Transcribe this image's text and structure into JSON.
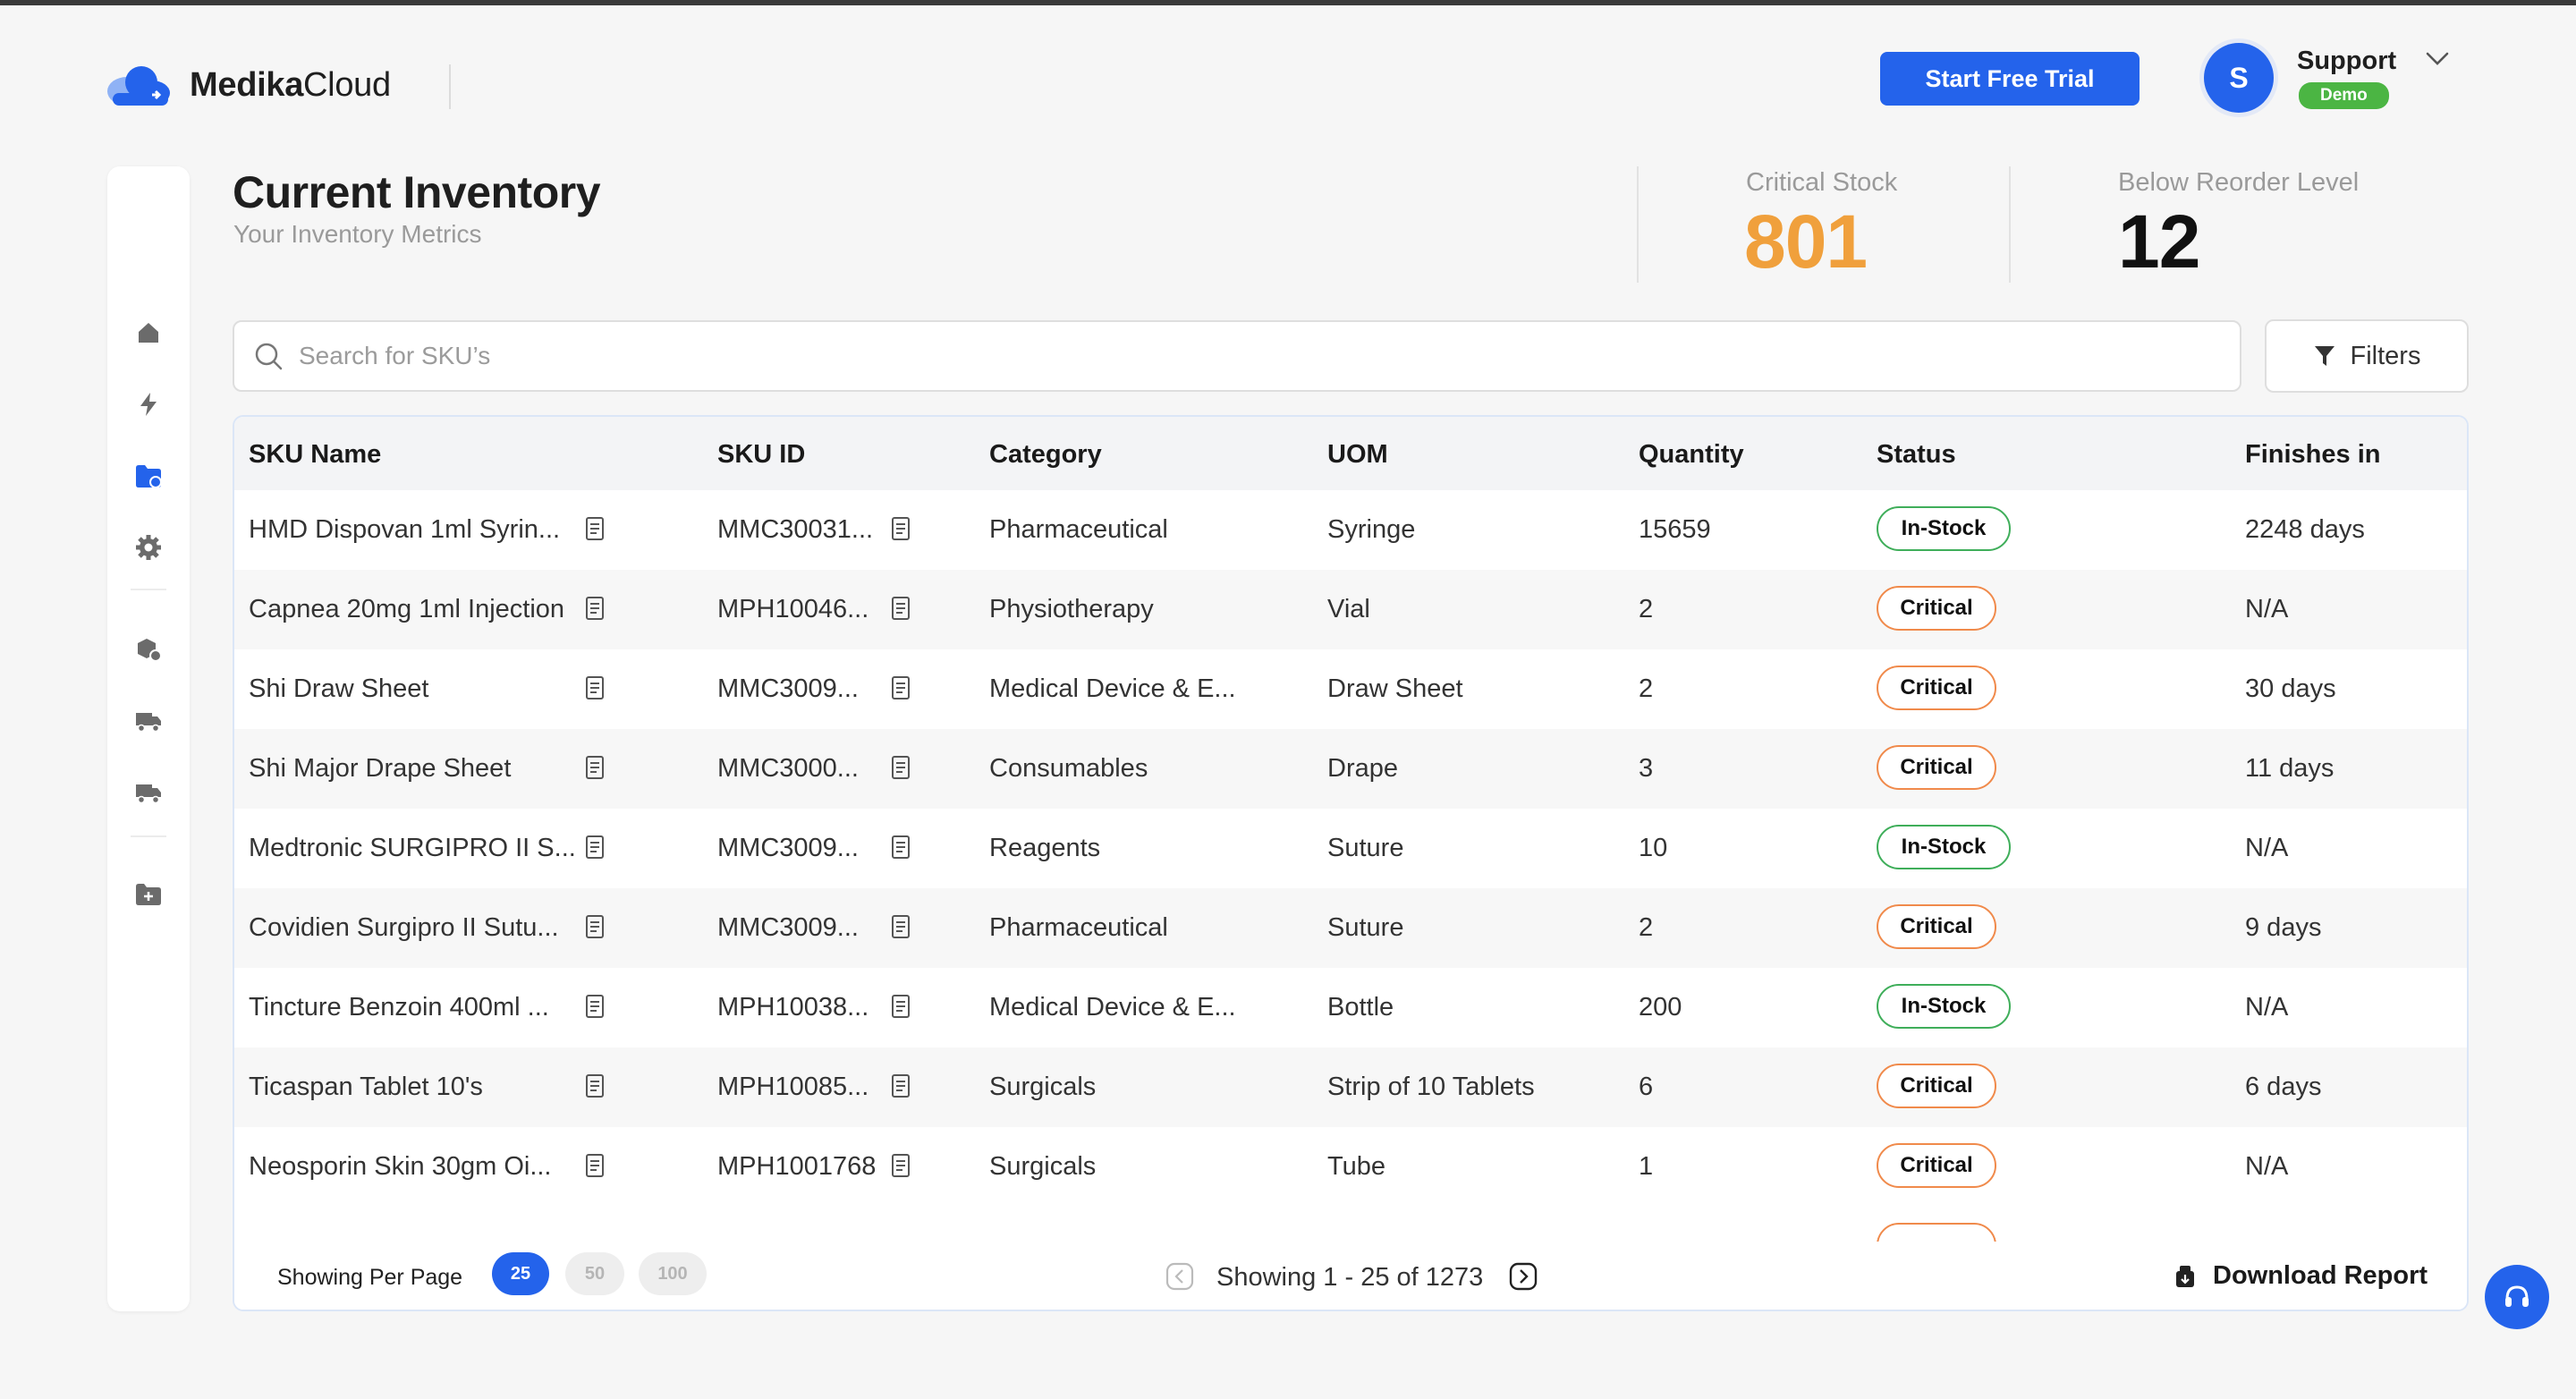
{
  "brand": {
    "name_bold": "Medika",
    "name_regular": "Cloud"
  },
  "header": {
    "trial_button": "Start Free Trial",
    "user": {
      "initial": "S",
      "name": "Support",
      "badge": "Demo"
    }
  },
  "sidebar": {
    "icons": [
      "home-icon",
      "lightning-icon",
      "inventory-folder-icon",
      "settings-gear-icon",
      "boxes-settings-icon",
      "delivery-truck-icon",
      "delivery-truck-alt-icon",
      "add-folder-icon"
    ],
    "active": "inventory-folder-icon"
  },
  "page": {
    "title": "Current Inventory",
    "subtitle": "Your Inventory Metrics"
  },
  "stats": {
    "critical": {
      "label": "Critical Stock",
      "value": "801",
      "color": "#f0a03c"
    },
    "reorder": {
      "label": "Below Reorder Level",
      "value": "12",
      "color": "#111111"
    }
  },
  "search": {
    "placeholder": "Search for SKU’s"
  },
  "filters_label": "Filters",
  "table": {
    "headers": {
      "sku_name": "SKU Name",
      "sku_id": "SKU ID",
      "category": "Category",
      "uom": "UOM",
      "quantity": "Quantity",
      "status": "Status",
      "finishes": "Finishes in"
    },
    "rows": [
      {
        "name": "HMD Dispovan 1ml Syrin...",
        "id": "MMC30031...",
        "category": "Pharmaceutical",
        "uom": "Syringe",
        "quantity": "15659",
        "status": "In-Stock",
        "finishes": "2248 days"
      },
      {
        "name": "Capnea 20mg 1ml Injection",
        "id": "MPH10046...",
        "category": "Physiotherapy",
        "uom": "Vial",
        "quantity": "2",
        "status": "Critical",
        "finishes": "N/A"
      },
      {
        "name": "Shi Draw Sheet",
        "id": "MMC3009...",
        "category": "Medical Device & E...",
        "uom": "Draw Sheet",
        "quantity": "2",
        "status": "Critical",
        "finishes": "30 days"
      },
      {
        "name": "Shi Major Drape Sheet",
        "id": "MMC3000...",
        "category": "Consumables",
        "uom": "Drape",
        "quantity": "3",
        "status": "Critical",
        "finishes": "11 days"
      },
      {
        "name": "Medtronic SURGIPRO II S...",
        "id": "MMC3009...",
        "category": "Reagents",
        "uom": "Suture",
        "quantity": "10",
        "status": "In-Stock",
        "finishes": "N/A"
      },
      {
        "name": "Covidien Surgipro II Sutu...",
        "id": "MMC3009...",
        "category": "Pharmaceutical",
        "uom": "Suture",
        "quantity": "2",
        "status": "Critical",
        "finishes": "9 days"
      },
      {
        "name": "Tincture Benzoin 400ml ...",
        "id": "MPH10038...",
        "category": "Medical Device & E...",
        "uom": "Bottle",
        "quantity": "200",
        "status": "In-Stock",
        "finishes": "N/A"
      },
      {
        "name": "Ticaspan Tablet 10's",
        "id": "MPH10085...",
        "category": "Surgicals",
        "uom": "Strip of 10 Tablets",
        "quantity": "6",
        "status": "Critical",
        "finishes": "6 days"
      },
      {
        "name": "Neosporin Skin 30gm Oi...",
        "id": "MPH1001768",
        "category": "Surgicals",
        "uom": "Tube",
        "quantity": "1",
        "status": "Critical",
        "finishes": "N/A"
      }
    ]
  },
  "footer": {
    "per_page_label": "Showing Per Page",
    "per_page_options": [
      "25",
      "50",
      "100"
    ],
    "per_page_selected": "25",
    "showing": "Showing 1 - 25 of 1273",
    "download": "Download Report"
  },
  "colors": {
    "primary": "#2463eb",
    "in_stock": "#3fae5a",
    "critical": "#f08a4b",
    "demo_badge": "#4bb543"
  }
}
